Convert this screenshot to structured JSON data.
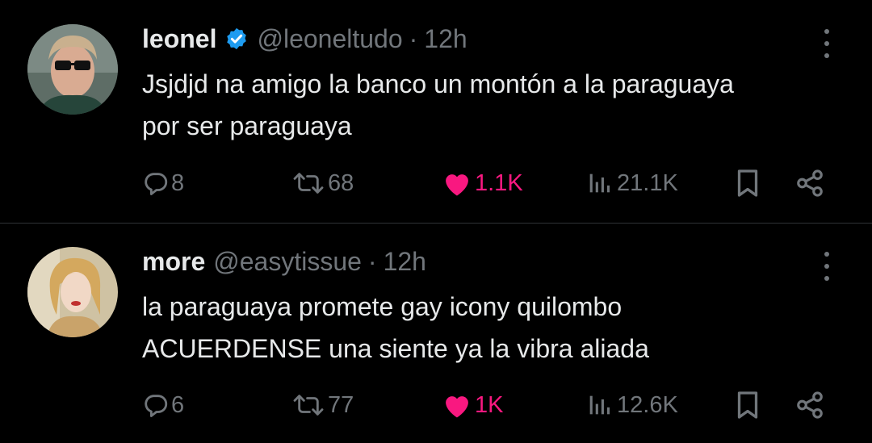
{
  "colors": {
    "background": "#000000",
    "text": "#e7e9ea",
    "muted": "#71767b",
    "like": "#f91880",
    "verified": "#1d9bf0",
    "divider": "#2f3336"
  },
  "tweets": [
    {
      "name": "leonel",
      "verified": true,
      "handle": "@leoneltudo",
      "separator": "·",
      "time": "12h",
      "text_lines": [
        "Jsjdjd na amigo la banco un montón a la paraguaya",
        "por ser paraguaya"
      ],
      "replies": "8",
      "retweets": "68",
      "likes": "1.1K",
      "liked": true,
      "views": "21.1K"
    },
    {
      "name": "more",
      "verified": false,
      "handle": "@easytissue",
      "separator": "·",
      "time": "12h",
      "text_lines": [
        "la paraguaya promete gay icony quilombo",
        "ACUERDENSE una siente ya la vibra aliada"
      ],
      "replies": "6",
      "retweets": "77",
      "likes": "1K",
      "liked": true,
      "views": "12.6K"
    }
  ],
  "icons": {
    "reply": "reply-icon",
    "retweet": "retweet-icon",
    "like": "heart-icon",
    "views": "views-icon",
    "bookmark": "bookmark-icon",
    "share": "share-icon",
    "more": "more-icon",
    "verified": "verified-badge-icon"
  }
}
